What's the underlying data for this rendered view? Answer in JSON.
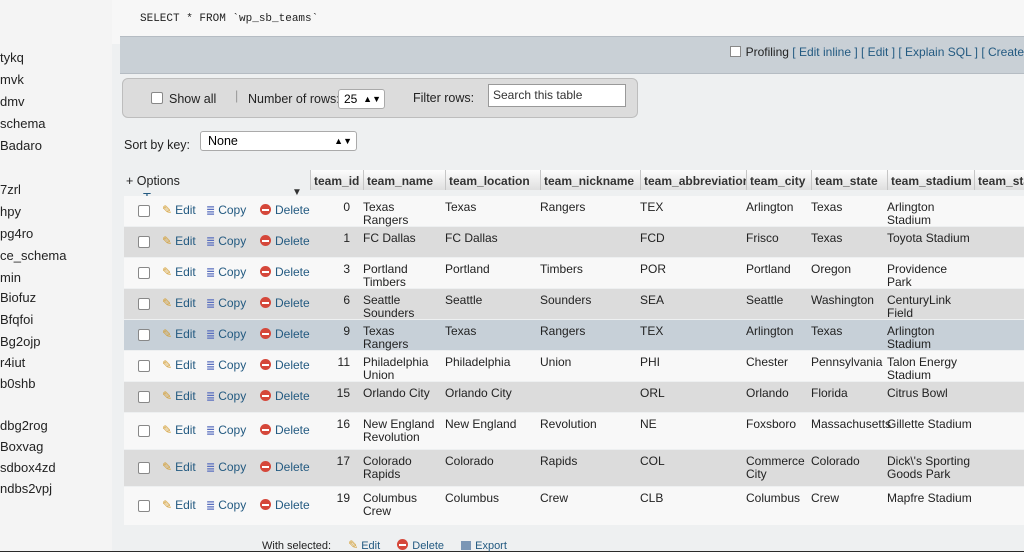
{
  "sidebar": {
    "items": [
      "tykq",
      "mvk",
      "dmv",
      "schema",
      "Badaro",
      "7zrl",
      "hpy",
      "pg4ro",
      "ce_schema",
      "min",
      "Biofuz",
      "Bfqfoi",
      "Bg2ojp",
      "r4iut",
      "b0shb",
      "dbg2rog",
      "Boxvag",
      "sdbox4zd",
      "ndbs2vpj"
    ]
  },
  "sql": {
    "query": "SELECT * FROM `wp_sb_teams`"
  },
  "profiling": {
    "label": "Profiling",
    "links": [
      "[ Edit inline ]",
      "[ Edit ]",
      "[ Explain SQL ]",
      "[ Create"
    ]
  },
  "nav": {
    "show_all": "Show all",
    "number_of_rows_label": "Number of rows:",
    "number_of_rows_value": "25",
    "filter_label": "Filter rows:",
    "filter_placeholder": "Search this table"
  },
  "sort": {
    "label": "Sort by key:",
    "value": "None"
  },
  "options": {
    "label": "+ Options"
  },
  "table": {
    "columns": [
      "team_id",
      "team_name",
      "team_location",
      "team_nickname",
      "team_abbreviation",
      "team_city",
      "team_state",
      "team_stadium",
      "team_stad"
    ],
    "actions": {
      "edit": "Edit",
      "copy": "Copy",
      "delete": "Delete"
    },
    "rows": [
      {
        "id": "0",
        "name": "Texas Rangers",
        "location": "Texas",
        "nickname": "Rangers",
        "abbr": "TEX",
        "city": "Arlington",
        "state": "Texas",
        "stadium": "Arlington Stadium"
      },
      {
        "id": "1",
        "name": "FC Dallas",
        "location": "FC Dallas",
        "nickname": "",
        "abbr": "FCD",
        "city": "Frisco",
        "state": "Texas",
        "stadium": "Toyota Stadium"
      },
      {
        "id": "3",
        "name": "Portland Timbers",
        "location": "Portland",
        "nickname": "Timbers",
        "abbr": "POR",
        "city": "Portland",
        "state": "Oregon",
        "stadium": "Providence Park"
      },
      {
        "id": "6",
        "name": "Seattle Sounders",
        "location": "Seattle",
        "nickname": "Sounders",
        "abbr": "SEA",
        "city": "Seattle",
        "state": "Washington",
        "stadium": "CenturyLink Field"
      },
      {
        "id": "9",
        "name": "Texas Rangers",
        "location": "Texas",
        "nickname": "Rangers",
        "abbr": "TEX",
        "city": "Arlington",
        "state": "Texas",
        "stadium": "Arlington Stadium"
      },
      {
        "id": "11",
        "name": "Philadelphia Union",
        "location": "Philadelphia",
        "nickname": "Union",
        "abbr": "PHI",
        "city": "Chester",
        "state": "Pennsylvania",
        "stadium": "Talon Energy Stadium"
      },
      {
        "id": "15",
        "name": "Orlando City",
        "location": "Orlando City",
        "nickname": "",
        "abbr": "ORL",
        "city": "Orlando",
        "state": "Florida",
        "stadium": "Citrus Bowl"
      },
      {
        "id": "16",
        "name": "New England Revolution",
        "location": "New England",
        "nickname": "Revolution",
        "abbr": "NE",
        "city": "Foxsboro",
        "state": "Massachusetts",
        "stadium": "Gillette Stadium"
      },
      {
        "id": "17",
        "name": "Colorado Rapids",
        "location": "Colorado",
        "nickname": "Rapids",
        "abbr": "COL",
        "city": "Commerce City",
        "state": "Colorado",
        "stadium": "Dick\\'s Sporting Goods Park"
      },
      {
        "id": "19",
        "name": "Columbus Crew",
        "location": "Columbus",
        "nickname": "Crew",
        "abbr": "CLB",
        "city": "Columbus",
        "state": "Crew",
        "stadium": "Mapfre Stadium"
      }
    ]
  },
  "bulk": {
    "label": "With selected:",
    "edit": "Edit",
    "delete": "Delete",
    "export": "Export"
  }
}
